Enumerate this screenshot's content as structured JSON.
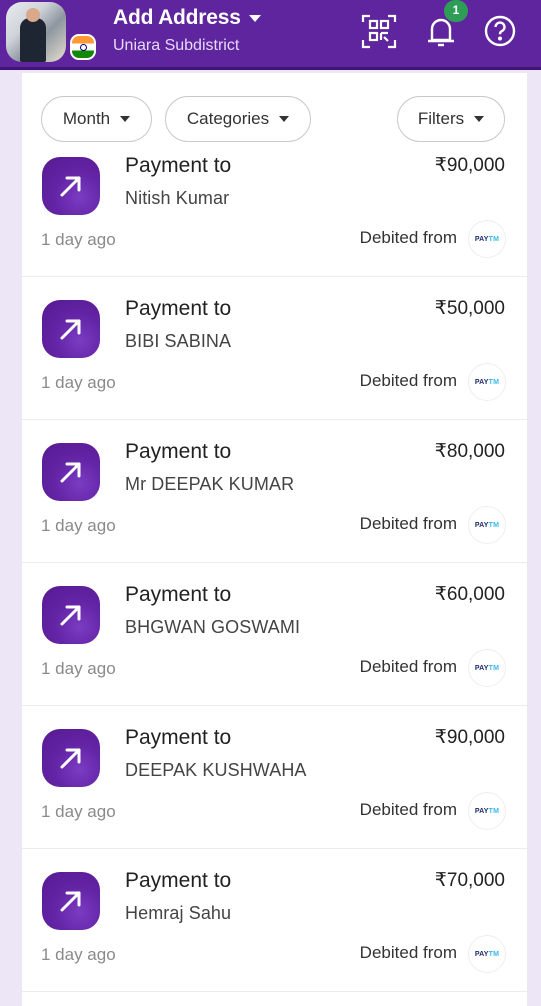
{
  "header": {
    "title": "Add Address",
    "subtitle": "Uniara Subdistrict",
    "notification_count": "1",
    "icons": {
      "avatar": "profile-avatar",
      "flag": "india-flag-icon",
      "qr": "qr-scan-icon",
      "bell": "bell-icon",
      "help": "help-icon"
    },
    "colors": {
      "brand": "#5f259f",
      "badge": "#2e9e57"
    }
  },
  "filters": {
    "month_label": "Month",
    "categories_label": "Categories",
    "filters_label": "Filters"
  },
  "transactions": [
    {
      "label": "Payment to",
      "name": "Nitish Kumar",
      "amount": "₹90,000",
      "time": "1 day ago",
      "debit_label": "Debited from",
      "source_pay": "PAY",
      "source_tm": "TM"
    },
    {
      "label": "Payment to",
      "name": "BIBI SABINA",
      "amount": "₹50,000",
      "time": "1 day ago",
      "debit_label": "Debited from",
      "source_pay": "PAY",
      "source_tm": "TM"
    },
    {
      "label": "Payment to",
      "name": "Mr DEEPAK  KUMAR",
      "amount": "₹80,000",
      "time": "1 day ago",
      "debit_label": "Debited from",
      "source_pay": "PAY",
      "source_tm": "TM"
    },
    {
      "label": "Payment to",
      "name": "BHGWAN  GOSWAMI",
      "amount": "₹60,000",
      "time": "1 day ago",
      "debit_label": "Debited from",
      "source_pay": "PAY",
      "source_tm": "TM"
    },
    {
      "label": "Payment to",
      "name": "DEEPAK KUSHWAHA",
      "amount": "₹90,000",
      "time": "1 day ago",
      "debit_label": "Debited from",
      "source_pay": "PAY",
      "source_tm": "TM"
    },
    {
      "label": "Payment to",
      "name": "Hemraj Sahu",
      "amount": "₹70,000",
      "time": "1 day ago",
      "debit_label": "Debited from",
      "source_pay": "PAY",
      "source_tm": "TM"
    }
  ]
}
